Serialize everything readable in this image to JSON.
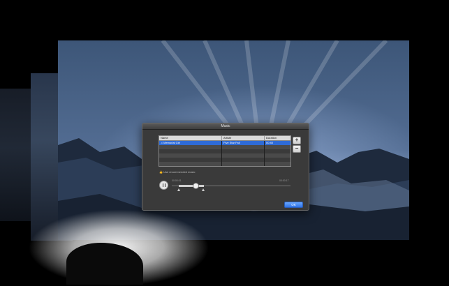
{
  "dialog": {
    "title": "Music",
    "table": {
      "headers": [
        "Name",
        "Artiste",
        "Duration"
      ],
      "rows": [
        {
          "name": "Memorial Girl",
          "artist": "Five Star Fall",
          "duration": "00:40"
        }
      ]
    },
    "add_label": "+",
    "remove_label": "−",
    "recommend_label": "Use recommended music",
    "player": {
      "time_start": "00:00:01",
      "time_end": "00:00:17"
    },
    "ok_label": "OK"
  }
}
